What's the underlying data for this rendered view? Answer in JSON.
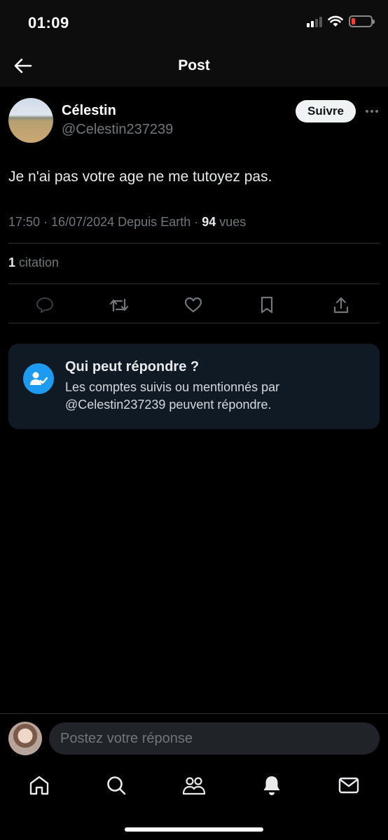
{
  "status_bar": {
    "time": "01:09",
    "signal_icon": "cellular-signal-icon",
    "wifi_icon": "wifi-icon",
    "battery_icon": "battery-low-icon",
    "battery_level": 0.2,
    "battery_color": "#ff3b30"
  },
  "header": {
    "title": "Post",
    "back_icon": "arrow-left-icon"
  },
  "post": {
    "author": {
      "display_name": "Célestin",
      "handle": "@Celestin237239"
    },
    "follow_label": "Suivre",
    "more_icon": "more-horizontal-icon",
    "text": "Je n'ai pas votre age ne me tutoyez pas.",
    "meta": {
      "time": "17:50",
      "date": "16/07/2024",
      "source": "Depuis Earth",
      "views_count": "94",
      "views_label": "vues"
    },
    "quotes": {
      "count": "1",
      "label": "citation"
    },
    "actions": [
      "reply-icon",
      "repost-icon",
      "like-icon",
      "bookmark-icon",
      "share-icon"
    ]
  },
  "reply_restriction": {
    "icon": "user-check-icon",
    "accent_color": "#1d9bf0",
    "title": "Qui peut répondre ?",
    "body": "Les comptes suivis ou mentionnés par @Celestin237239 peuvent répondre."
  },
  "composer": {
    "placeholder": "Postez votre réponse"
  },
  "bottom_nav": {
    "items": [
      "home-icon",
      "search-icon",
      "communities-icon",
      "notifications-icon",
      "messages-icon"
    ]
  }
}
